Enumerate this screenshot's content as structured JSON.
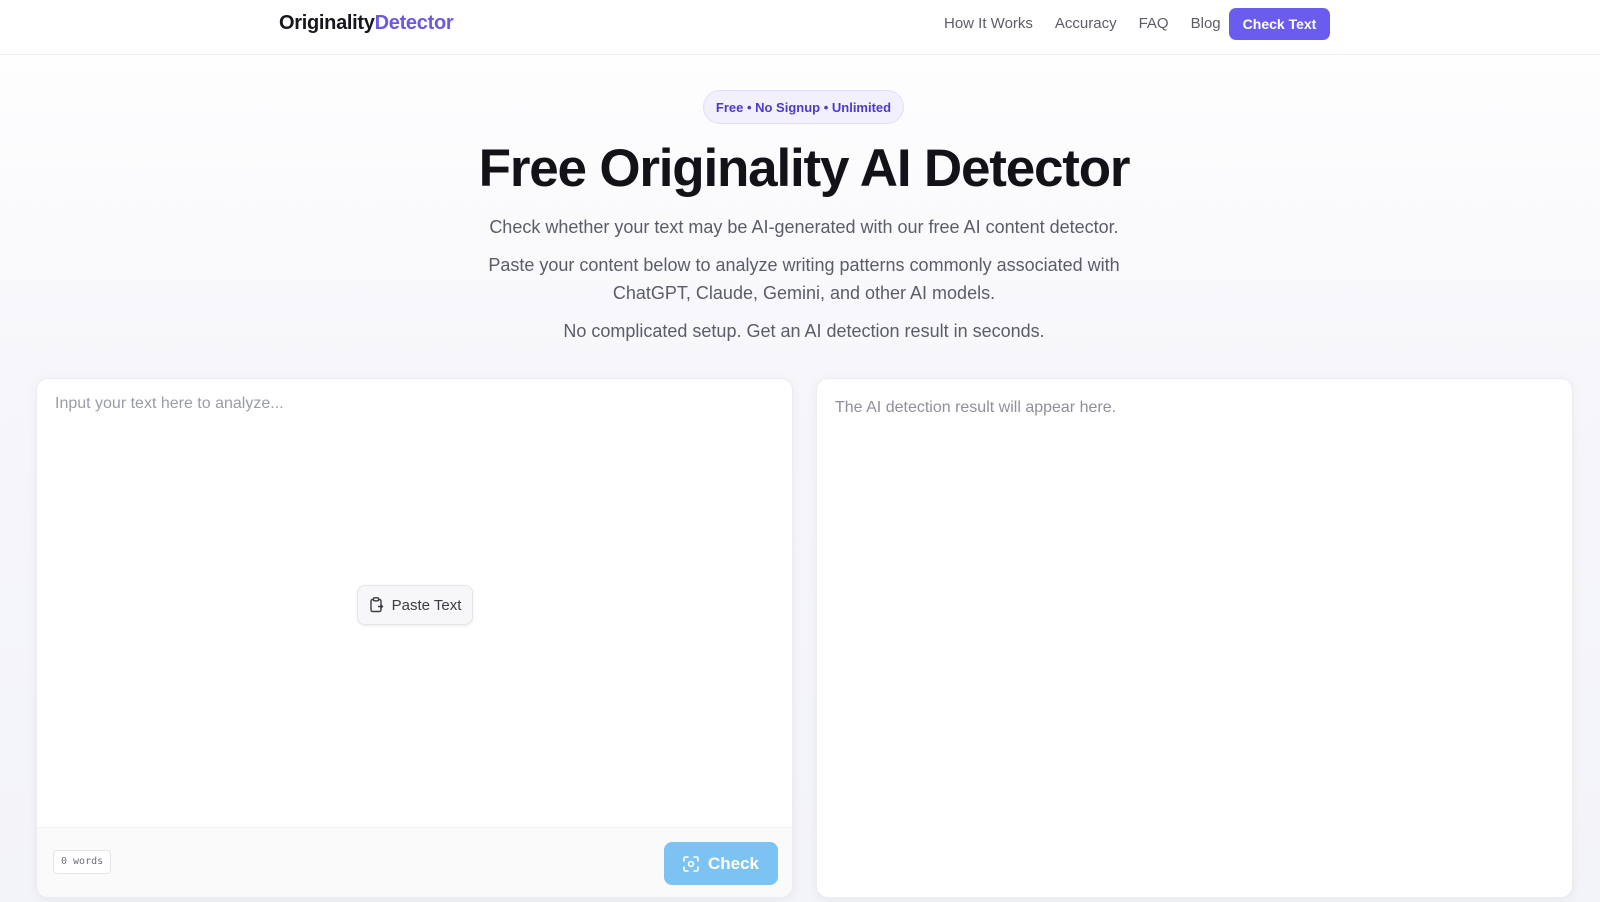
{
  "header": {
    "logo_main": "Originality",
    "logo_accent": "Detector",
    "nav": [
      "How It Works",
      "Accuracy",
      "FAQ",
      "Blog"
    ],
    "cta_label": "Check Text"
  },
  "hero": {
    "pill": "Free • No Signup • Unlimited",
    "title": "Free Originality AI Detector",
    "subtitle1": "Check whether your text may be AI-generated with our free AI content detector.",
    "subtitle2": "Paste your content below to analyze writing patterns commonly associated with ChatGPT, Claude, Gemini, and other AI models.",
    "subtitle3": "No complicated setup. Get an AI detection result in seconds."
  },
  "input_panel": {
    "placeholder": "Input your text here to analyze...",
    "value": "",
    "paste_label": "Paste Text",
    "paste_icon": "clipboard-icon",
    "word_count": "0 words",
    "check_label": "Check",
    "check_icon": "scan-icon"
  },
  "result_panel": {
    "placeholder": "The AI detection result will appear here."
  },
  "colors": {
    "brand": "#6b5cf0",
    "check_button": "#7cc3f4",
    "pill_bg": "#f2f0fd"
  }
}
